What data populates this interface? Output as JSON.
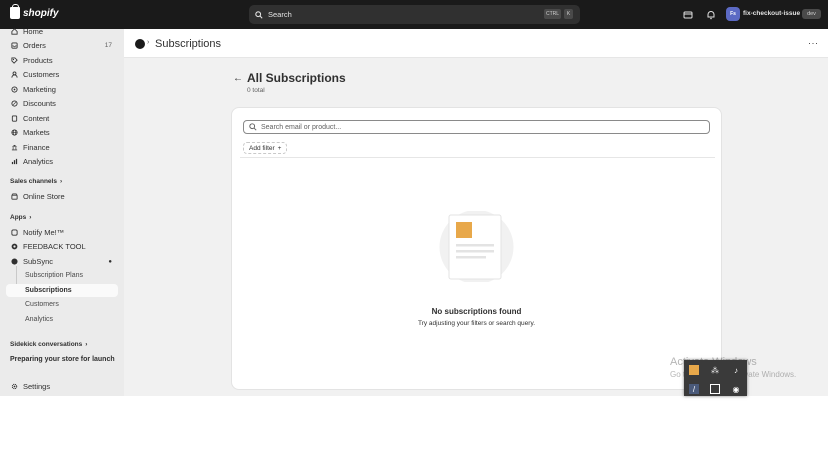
{
  "topbar": {
    "logo_text": "shopify",
    "search_label": "Search",
    "shortcut_ctrl": "CTRL",
    "shortcut_k": "K",
    "avatar_initials": "Fs",
    "store_name": "fix-checkout-issue",
    "env_badge": "dev"
  },
  "sidebar": {
    "items": [
      {
        "label": "Home",
        "icon": "home-icon"
      },
      {
        "label": "Orders",
        "icon": "inbox-icon",
        "count": "17"
      },
      {
        "label": "Products",
        "icon": "tag-icon"
      },
      {
        "label": "Customers",
        "icon": "person-icon"
      },
      {
        "label": "Marketing",
        "icon": "target-icon"
      },
      {
        "label": "Discounts",
        "icon": "discount-icon"
      },
      {
        "label": "Content",
        "icon": "document-icon"
      },
      {
        "label": "Markets",
        "icon": "globe-icon"
      },
      {
        "label": "Finance",
        "icon": "bank-icon"
      },
      {
        "label": "Analytics",
        "icon": "chart-icon"
      }
    ],
    "sales_channels_label": "Sales channels",
    "online_store_label": "Online Store",
    "apps_label": "Apps",
    "apps": [
      {
        "label": "Notify Me!™"
      },
      {
        "label": "FEEDBACK TOOL"
      },
      {
        "label": "SubSync"
      }
    ],
    "subsync_children": [
      {
        "label": "Subscription Plans"
      },
      {
        "label": "Subscriptions"
      },
      {
        "label": "Customers"
      },
      {
        "label": "Analytics"
      }
    ],
    "sidekick_label": "Sidekick conversations",
    "prep_label": "Preparing your store for launch",
    "settings_label": "Settings"
  },
  "header": {
    "title": "Subscriptions"
  },
  "page": {
    "title": "All Subscriptions",
    "count": "0 total",
    "search_placeholder": "Search email or product...",
    "add_filter_label": "Add filter",
    "add_filter_plus": "+",
    "empty_title": "No subscriptions found",
    "empty_subtitle": "Try adjusting your filters or search query."
  },
  "overlay": {
    "watermark_title": "Activate Windows",
    "watermark_sub": "Go to Settings to activate Windows."
  },
  "colors": {
    "topbar_bg": "#1a1a1a",
    "sidebar_bg": "#ebebeb",
    "main_bg": "#f1f1f1",
    "card_bg": "#ffffff",
    "illustration_accent": "#e8a84a"
  }
}
